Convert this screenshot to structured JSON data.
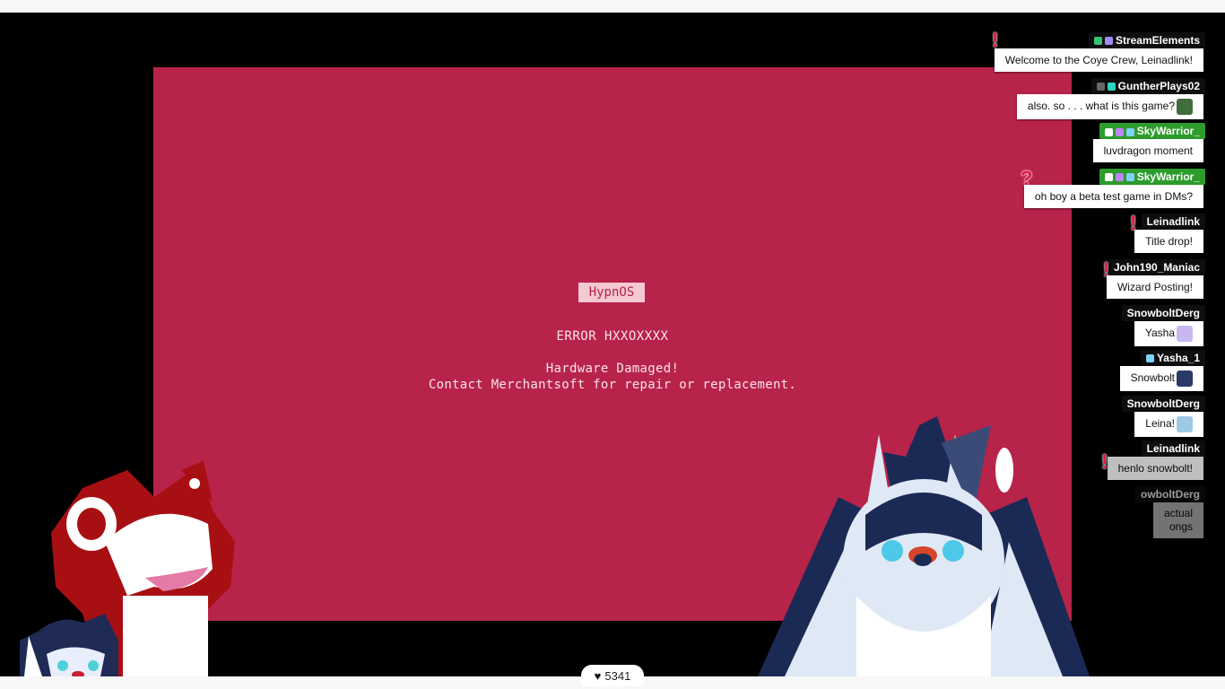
{
  "game": {
    "os_name": "HypnOS",
    "error_code": "ERROR HXXOXXXX",
    "message_line1": "Hardware Damaged!",
    "message_line2": "Contact Merchantsoft for repair or replacement."
  },
  "chat": {
    "messages": [
      {
        "user": "StreamElements",
        "text": "Welcome to the Coye Crew, Leinadlink!",
        "name_style": "dark"
      },
      {
        "user": "GuntherPlays02",
        "text": "also. so . . . what is this game?",
        "name_style": "dark"
      },
      {
        "user": "SkyWarrior_",
        "text": "luvdragon moment",
        "name_style": "green"
      },
      {
        "user": "SkyWarrior_",
        "text": "oh boy a beta test game in DMs?",
        "name_style": "green"
      },
      {
        "user": "Leinadlink",
        "text": "Title drop!",
        "name_style": "dark"
      },
      {
        "user": "John190_Maniac",
        "text": "Wizard Posting!",
        "name_style": "dark"
      },
      {
        "user": "SnowboltDerg",
        "text": "Yasha",
        "name_style": "dark"
      },
      {
        "user": "Yasha_1",
        "text": "Snowbolt",
        "name_style": "dark"
      },
      {
        "user": "SnowboltDerg",
        "text": "Leina!",
        "name_style": "dark"
      },
      {
        "user": "Leinadlink",
        "text": "henlo snowbolt!",
        "name_style": "dark"
      },
      {
        "user": "owboltDerg",
        "text": "actual",
        "text2": "ongs",
        "name_style": "dark"
      }
    ]
  },
  "counter": {
    "icon": "heart-icon",
    "value": "5341"
  },
  "colors": {
    "screen_red": "#b8234a",
    "green_tag": "#2d9c2d",
    "alert_red": "#e8143c"
  }
}
